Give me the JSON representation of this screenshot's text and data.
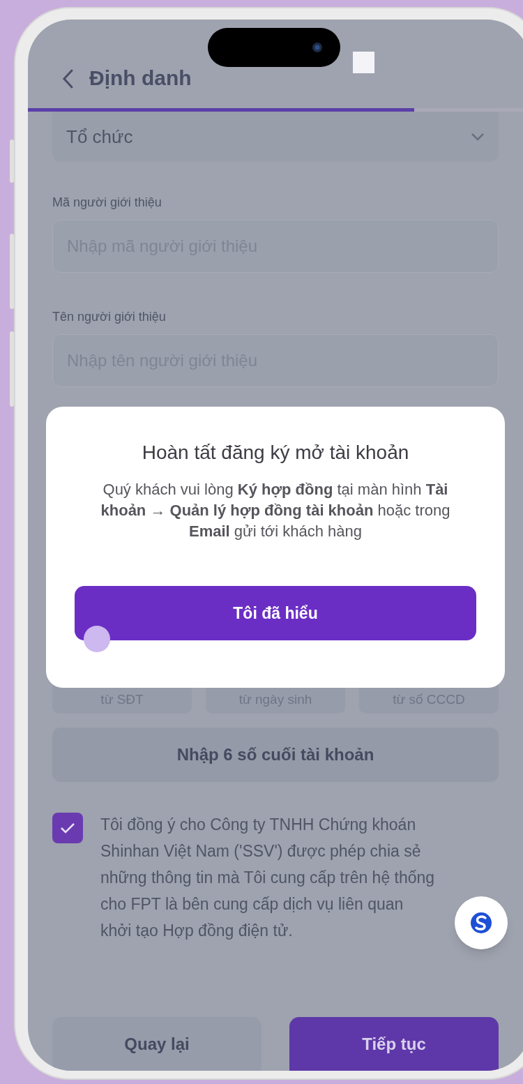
{
  "header": {
    "title": "Định danh",
    "progress": {
      "level": 0.77
    }
  },
  "form": {
    "select": {
      "value": "Tổ chức"
    },
    "fields": [
      {
        "label": "Mã người giới thiệu",
        "placeholder": "Nhập mã người giới thiệu"
      },
      {
        "label": "Tên người giới thiệu",
        "placeholder": "Nhập tên người giới thiệu"
      }
    ]
  },
  "verify_options": [
    "từ SĐT",
    "từ ngày sinh",
    "từ số CCCD"
  ],
  "account_button": "Nhập 6 số cuối tài khoản",
  "consent": {
    "checked": true,
    "lines": [
      "Tôi đồng ý cho Công ty TNHH Chứng khoán",
      "Shinhan Việt Nam ('SSV') được phép chia sẻ",
      "những thông tin mà Tôi cung cấp trên hệ thống",
      "cho FPT là bên cung cấp dịch vụ liên quan",
      "khởi tạo Hợp đồng điện tử."
    ]
  },
  "buttons": [
    {
      "label": "Quay lại",
      "kind": "secondary"
    },
    {
      "label": "Tiếp tục",
      "kind": "primary"
    }
  ],
  "dialog": {
    "title": "Hoàn tất đăng ký mở tài khoản",
    "message": "Quý khách vui lòng **Ký hợp đồng** tại màn hình **Tài khoản → Quản lý hợp đồng tài khoản** hoặc trong **Email** gửi tới khách hàng",
    "button": "Tôi đã hiểu"
  }
}
